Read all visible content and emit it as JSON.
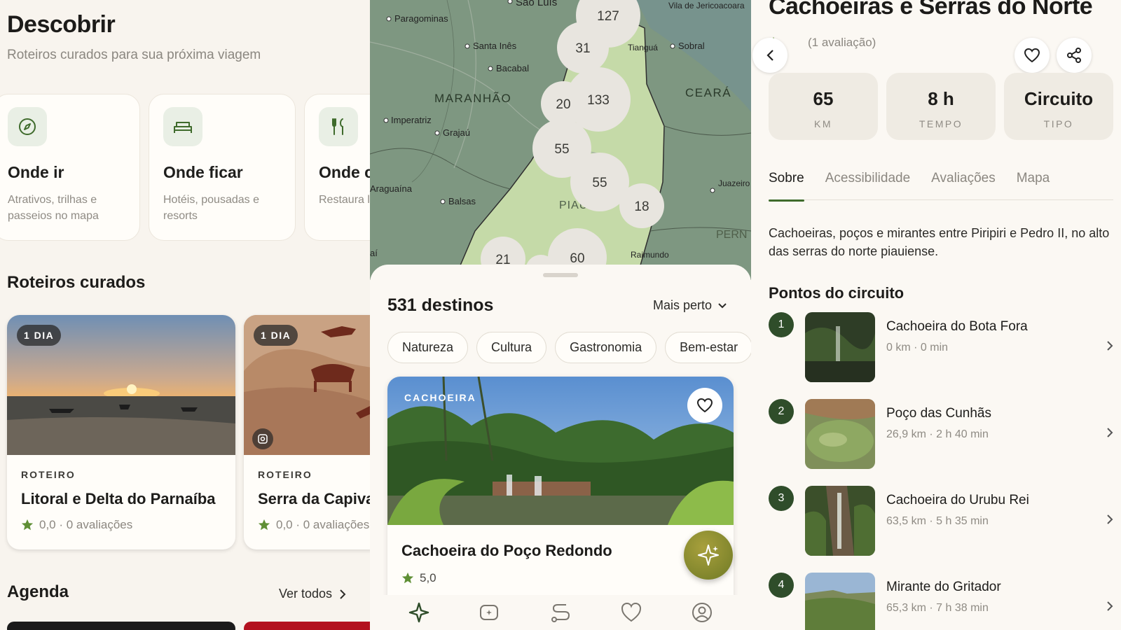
{
  "discover": {
    "title": "Descobrir",
    "subtitle": "Roteiros curados para sua próxima viagem",
    "categories": [
      {
        "icon": "compass-icon",
        "name": "Onde ir",
        "desc": "Atrativos, trilhas e passeios no mapa"
      },
      {
        "icon": "bed-icon",
        "name": "Onde ficar",
        "desc": "Hotéis, pousadas e resorts"
      },
      {
        "icon": "utensils-icon",
        "name": "Onde c",
        "desc": "Restaura locais"
      }
    ],
    "curated_title": "Roteiros curados",
    "routes": [
      {
        "badge": "1 DIA",
        "kicker": "ROTEIRO",
        "name": "Litoral e Delta do Parnaíba",
        "rating": "0,0 · 0 avaliações"
      },
      {
        "badge": "1 DIA",
        "kicker": "ROTEIRO",
        "name": "Serra da Capiva",
        "rating": "0,0 · 0 avaliações"
      }
    ],
    "agenda_title": "Agenda",
    "agenda_link": "Ver todos"
  },
  "map_panel": {
    "place_labels": [
      "Paragominas",
      "São Luís",
      "Santa Inês",
      "Bacabal",
      "MARANHÃO",
      "Imperatriz",
      "Grajaú",
      "Balsas",
      "Araguaína",
      "PIAUÍ",
      "CEARÁ",
      "Sobral",
      "Vila de Jericoacoara",
      "Juazeiro do Norte",
      "PERN",
      "Tianguá",
      "Raimundo",
      "aí"
    ],
    "clusters": [
      "127",
      "31",
      "133",
      "20",
      "55",
      "55",
      "18",
      "21",
      "60"
    ],
    "dest_count": "531 destinos",
    "sort_label": "Mais perto",
    "chips": [
      "Natureza",
      "Cultura",
      "Gastronomia",
      "Bem-estar"
    ],
    "card": {
      "kicker": "CACHOEIRA",
      "name": "Cachoeira do Poço Redondo",
      "rating": "5,0"
    },
    "nav": [
      "sparkle-icon",
      "ai-chat-icon",
      "route-icon",
      "heart-icon",
      "profile-icon"
    ]
  },
  "detail": {
    "title": "Cachoeiras e Serras do Norte",
    "rating": "(1 avaliação)",
    "stats": [
      {
        "value": "65",
        "label": "KM"
      },
      {
        "value": "8 h",
        "label": "TEMPO"
      },
      {
        "value": "Circuito",
        "label": "TIPO"
      }
    ],
    "tabs": [
      "Sobre",
      "Acessibilidade",
      "Avaliações",
      "Mapa"
    ],
    "about": "Cachoeiras, poços e mirantes entre Piripiri e Pedro II, no alto das serras do norte piauiense.",
    "points_title": "Pontos do circuito",
    "points": [
      {
        "num": "1",
        "name": "Cachoeira do Bota Fora",
        "meta": "0 km · 0 min"
      },
      {
        "num": "2",
        "name": "Poço das Cunhãs",
        "meta": "26,9 km · 2 h 40 min"
      },
      {
        "num": "3",
        "name": "Cachoeira do Urubu Rei",
        "meta": "63,5 km · 5 h 35 min"
      },
      {
        "num": "4",
        "name": "Mirante do Gritador",
        "meta": "65,3 km · 7 h 38 min"
      }
    ]
  },
  "colors": {
    "accent": "#3f6b2c",
    "background": "#f8f4ee",
    "map_land": "#7f9a80",
    "map_state": "#c9dcab"
  }
}
